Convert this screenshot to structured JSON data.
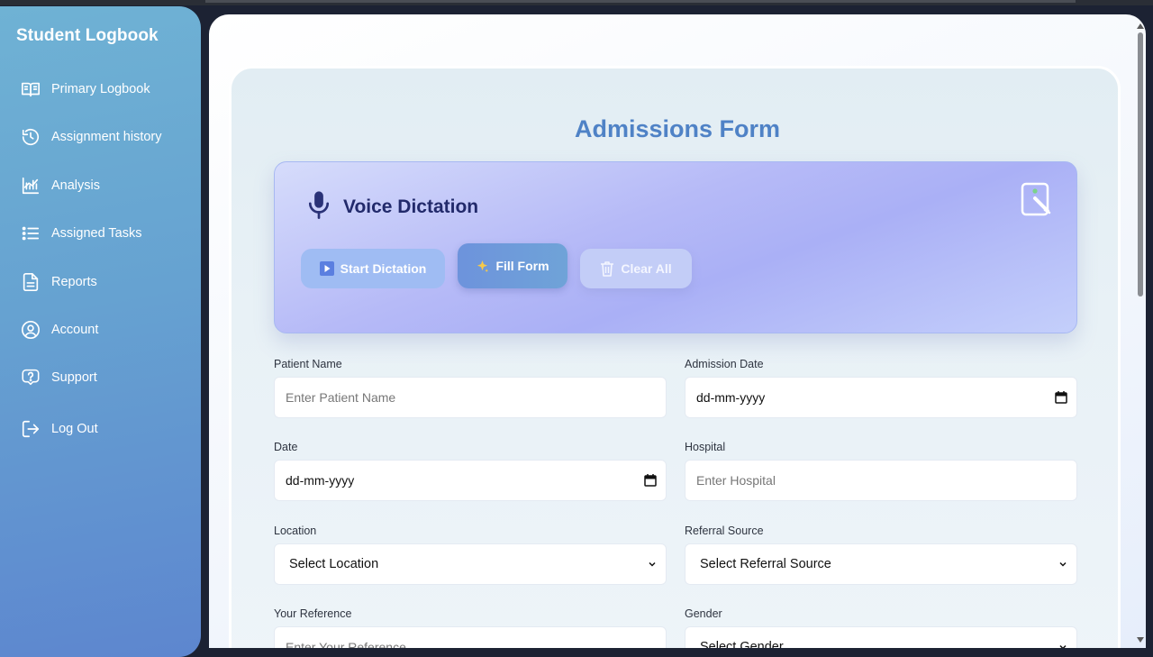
{
  "sidebar": {
    "title": "Student Logbook",
    "items": [
      {
        "label": "Primary Logbook",
        "icon": "book-open-icon"
      },
      {
        "label": "Assignment history",
        "icon": "history-icon"
      },
      {
        "label": "Analysis",
        "icon": "analysis-icon"
      },
      {
        "label": "Assigned Tasks",
        "icon": "list-icon"
      },
      {
        "label": "Reports",
        "icon": "document-icon"
      },
      {
        "label": "Account",
        "icon": "user-circle-icon"
      },
      {
        "label": "Support",
        "icon": "help-icon"
      },
      {
        "label": "Log Out",
        "icon": "logout-icon"
      }
    ]
  },
  "form": {
    "title": "Admissions Form",
    "voice": {
      "title": "Voice Dictation",
      "start_label": "Start Dictation",
      "fill_label": "Fill Form",
      "clear_label": "Clear All"
    },
    "fields": {
      "patient_name": {
        "label": "Patient Name",
        "placeholder": "Enter Patient Name"
      },
      "admission_date": {
        "label": "Admission Date",
        "value": "dd-mm-yyyy"
      },
      "date": {
        "label": "Date",
        "value": "dd-mm-yyyy"
      },
      "hospital": {
        "label": "Hospital",
        "placeholder": "Enter Hospital"
      },
      "location": {
        "label": "Location",
        "value": "Select Location"
      },
      "referral_source": {
        "label": "Referral Source",
        "value": "Select Referral Source"
      },
      "your_reference": {
        "label": "Your Reference",
        "placeholder": "Enter Your Reference"
      },
      "gender": {
        "label": "Gender",
        "value": "Select Gender"
      }
    }
  },
  "colors": {
    "accent": "#4f82c6",
    "sidebar_top": "#6fb2d4",
    "sidebar_bottom": "#5d86cf",
    "voice_title": "#222a6b"
  }
}
